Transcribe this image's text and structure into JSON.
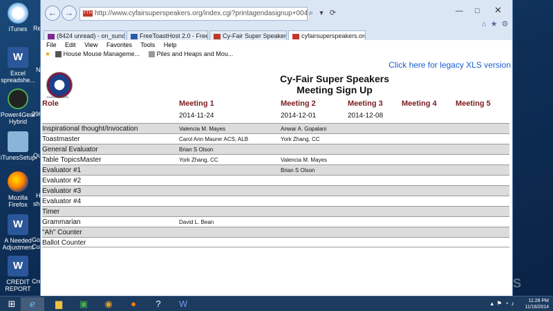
{
  "desktop": {
    "icons": [
      {
        "label": "iTunes",
        "kind": "itunes"
      },
      {
        "label": "Excel spreadshe...",
        "kind": "excel"
      },
      {
        "label": "Power4Gear Hybrid",
        "kind": "gauge"
      },
      {
        "label": "iTunesSetup",
        "kind": "setup"
      },
      {
        "label": "Mozilla Firefox",
        "kind": "firefox"
      },
      {
        "label": "A Needed Adjustment",
        "kind": "word"
      },
      {
        "label": "CREDIT REPORT",
        "kind": "word"
      }
    ],
    "partial_labels": [
      "Re",
      "N",
      "296",
      "Qu",
      "H",
      "sh",
      "Go",
      "Cu",
      "Cre"
    ],
    "watermark": "S"
  },
  "browser": {
    "address": "http://www.cyfairsuperspeakers.org/index.cgi?printagendasignup+00413943",
    "favicon_text": "FTH",
    "address_tools": "⌕ ▾ ⟳",
    "tabs": [
      {
        "label": "(8424 unread) - on_sunday_str...",
        "color": "#7a2b8c",
        "active": false
      },
      {
        "label": "FreeToastHost 2.0 - FreeToast...",
        "color": "#2b5aa8",
        "active": false
      },
      {
        "label": "Cy-Fair Super Speakers",
        "color": "#c0392b",
        "active": false
      },
      {
        "label": "cyfairsuperspeakers.org",
        "color": "#c0392b",
        "active": true
      }
    ],
    "menu": [
      "File",
      "Edit",
      "View",
      "Favorites",
      "Tools",
      "Help"
    ],
    "favorites": [
      "House Mouse Manageme...",
      "Piles and Heaps and Mou..."
    ]
  },
  "page": {
    "legacy_link": "Click here for legacy XLS version",
    "logo_text": "TOASTMASTERS",
    "title_line1": "Cy-Fair Super Speakers",
    "title_line2": "Meeting Sign Up",
    "role_header": "Role",
    "meetings": [
      {
        "label": "Meeting 1",
        "date": "2014-11-24"
      },
      {
        "label": "Meeting 2",
        "date": "2014-12-01"
      },
      {
        "label": "Meeting 3",
        "date": "2014-12-08"
      },
      {
        "label": "Meeting 4",
        "date": ""
      },
      {
        "label": "Meeting 5",
        "date": ""
      }
    ],
    "rows": [
      {
        "role": "Inspirational thought/Invocation",
        "cells": [
          "Valencia M. Mayes",
          "Anwar A. Gopalani"
        ]
      },
      {
        "role": "Toastmaster",
        "cells": [
          "Carol Ann Maurer ACS, ALB",
          "York Zhang, CC"
        ]
      },
      {
        "role": "General Evaluator",
        "cells": [
          "Brian S Olson",
          ""
        ]
      },
      {
        "role": "Table TopicsMaster",
        "cells": [
          "York Zhang, CC",
          "Valencia M. Mayes"
        ]
      },
      {
        "role": "Evaluator #1",
        "cells": [
          "",
          "Brian S Olson"
        ]
      },
      {
        "role": "Evaluator #2",
        "cells": [
          "",
          ""
        ]
      },
      {
        "role": "Evaluator #3",
        "cells": [
          "",
          ""
        ]
      },
      {
        "role": "Evaluator #4",
        "cells": [
          "",
          ""
        ]
      },
      {
        "role": "Timer",
        "cells": [
          "",
          ""
        ]
      },
      {
        "role": "Grammarian",
        "cells": [
          "David L. Bean",
          ""
        ]
      },
      {
        "role": "\"Ah\" Counter",
        "cells": [
          "",
          ""
        ]
      },
      {
        "role": "Ballot Counter",
        "cells": [
          "",
          ""
        ]
      }
    ]
  },
  "taskbar": {
    "time": "11:28 PM",
    "date": "11/16/2014"
  }
}
